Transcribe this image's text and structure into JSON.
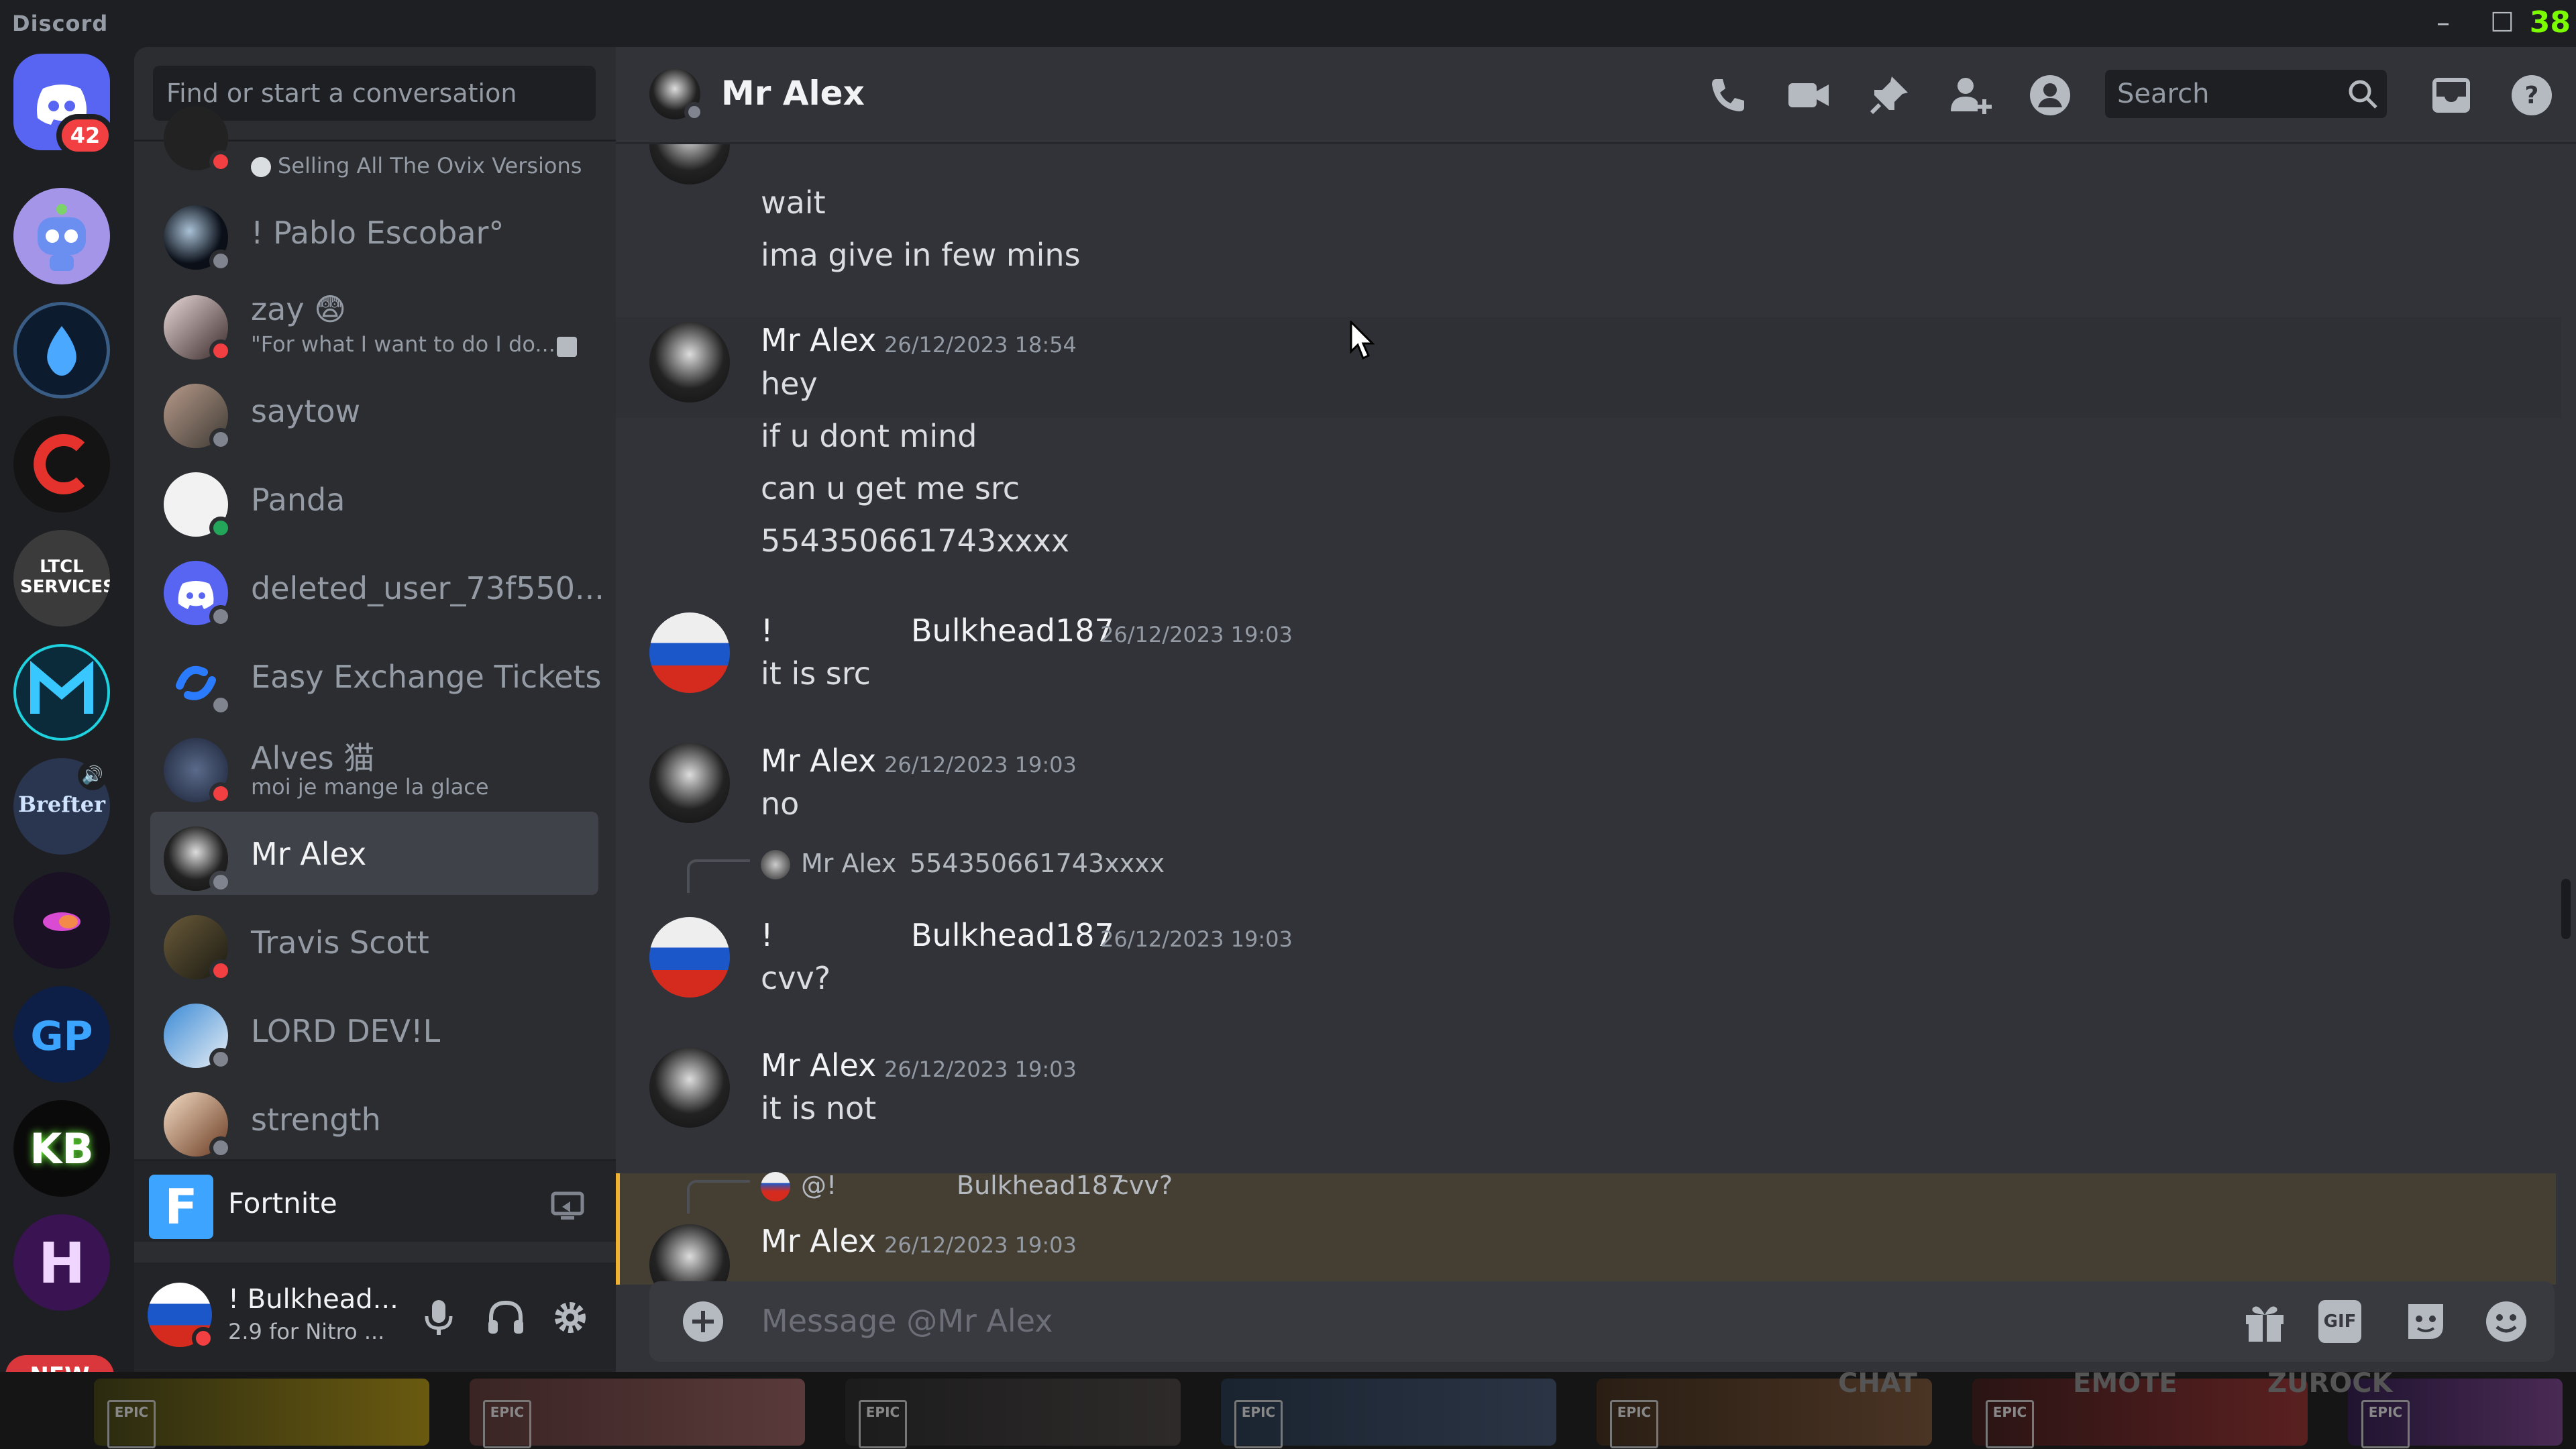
{
  "window": {
    "title": "Discord",
    "fps_counter": "38"
  },
  "servers": {
    "home_badge": "42",
    "new_label": "NEW",
    "ltcl_label": "LTCL SERVICES",
    "brefter_label": "Brefter",
    "gp_label": "GP",
    "kb_label": "KB",
    "h_label": "H"
  },
  "dm_search": {
    "placeholder": "Find or start a conversation"
  },
  "dms": [
    {
      "name": "",
      "sub": "Selling All The Ovix Versions"
    },
    {
      "name": "! Pablo Escobar°",
      "sub": ""
    },
    {
      "name": "zay 😨",
      "sub": "\"For what I want to do I do..."
    },
    {
      "name": "saytow",
      "sub": ""
    },
    {
      "name": "Panda",
      "sub": ""
    },
    {
      "name": "deleted_user_73f550...",
      "sub": ""
    },
    {
      "name": "Easy Exchange Tickets",
      "sub": ""
    },
    {
      "name": "Alves 猫",
      "sub": "moi je mange la glace"
    },
    {
      "name": "Mr Alex",
      "sub": ""
    },
    {
      "name": "Travis Scott",
      "sub": ""
    },
    {
      "name": "LORD DEV!L",
      "sub": ""
    },
    {
      "name": "strength",
      "sub": ""
    }
  ],
  "activity": {
    "name": "Fortnite"
  },
  "user": {
    "name": "! Bulkhead...",
    "status": "2.9 for Nitro ..."
  },
  "header": {
    "title": "Mr Alex",
    "search_placeholder": "Search"
  },
  "messages": {
    "g0": {
      "lines": [
        "wait",
        "ima give in few mins"
      ]
    },
    "g1": {
      "author": "Mr Alex",
      "time": "26/12/2023 18:54",
      "lines": [
        "hey",
        "if u dont mind",
        "can u get me src",
        "554350661743xxxx"
      ]
    },
    "g2": {
      "author_prefix": "!",
      "author": "Bulkhead187",
      "time": "26/12/2023 19:03",
      "lines": [
        "it is src"
      ]
    },
    "g3": {
      "author": "Mr Alex",
      "time": "26/12/2023 19:03",
      "lines": [
        "no"
      ]
    },
    "g4": {
      "reply_author": "Mr Alex",
      "reply_text": "554350661743xxxx",
      "author_prefix": "!",
      "author": "Bulkhead187",
      "time": "26/12/2023 19:03",
      "lines": [
        "cvv?"
      ]
    },
    "g5": {
      "author": "Mr Alex",
      "time": "26/12/2023 19:03",
      "lines": [
        "it is not"
      ]
    },
    "g6": {
      "reply_author": "@!",
      "reply_author2": "Bulkhead187",
      "reply_text": "cvv?",
      "author": "Mr Alex",
      "time": "26/12/2023 19:03"
    }
  },
  "composer": {
    "placeholder": "Message @Mr Alex",
    "gif_label": "GIF"
  },
  "taskbar": {
    "tiles": [
      "EPIC",
      "EPIC",
      "EPIC",
      "EPIC",
      "EPIC",
      "EPIC",
      "EPIC"
    ],
    "labels": [
      "CHAT",
      "EMOTE",
      "ZUROCK"
    ]
  },
  "colors": {
    "accent": "#5865f2",
    "mention_bg": "#443e33",
    "mention_bar": "#f0b232",
    "dnd": "#f23f42",
    "online": "#23a55a"
  }
}
